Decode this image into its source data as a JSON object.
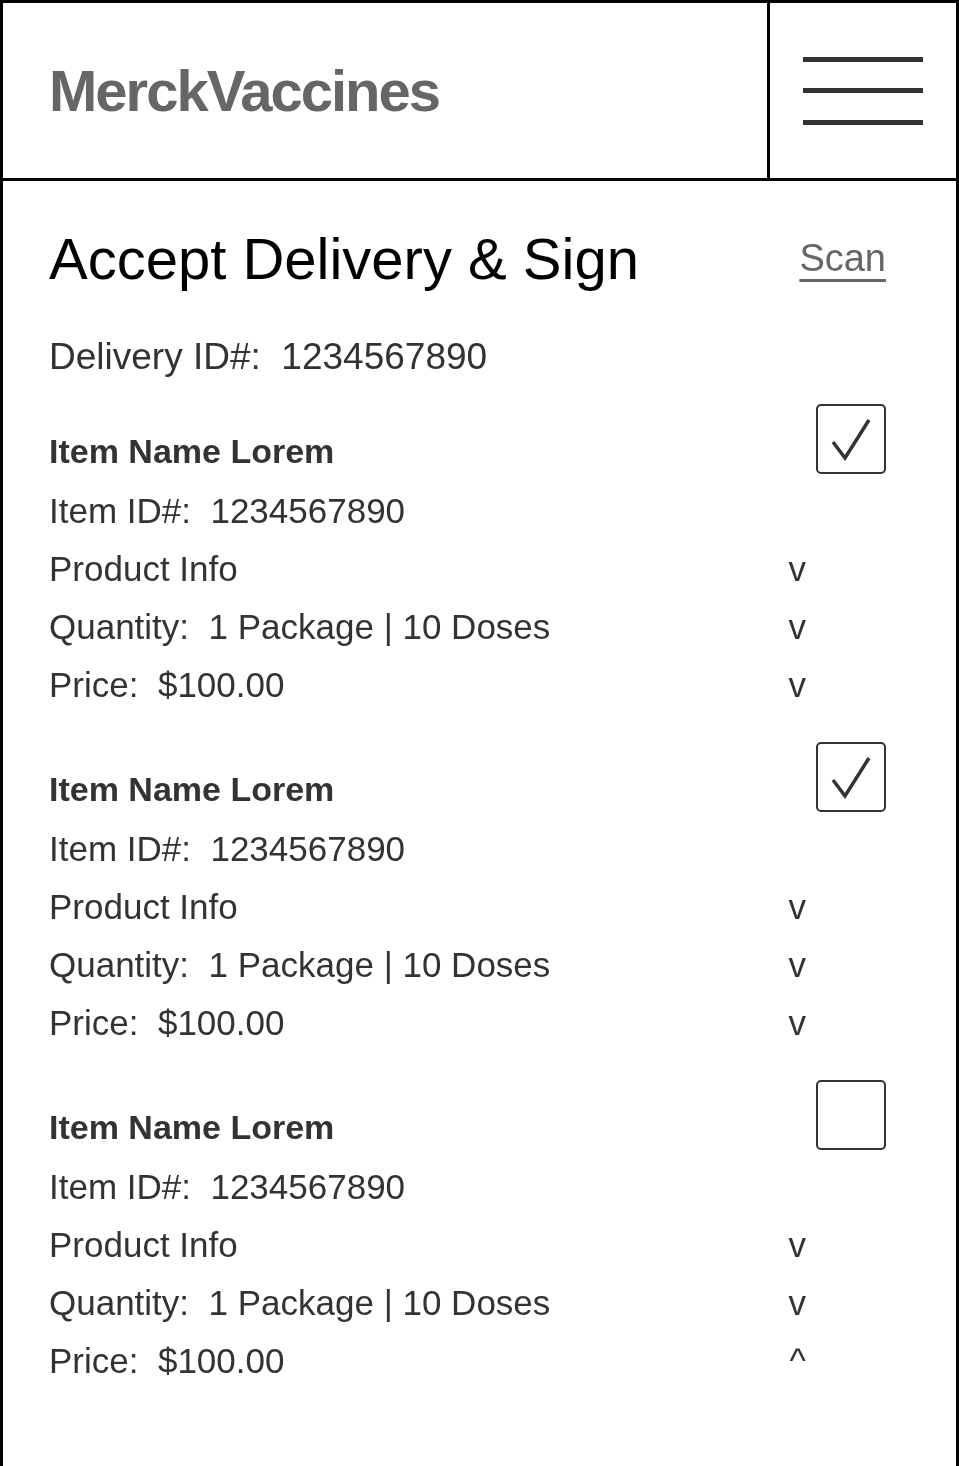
{
  "header": {
    "logo": "MerckVaccines"
  },
  "title": "Accept Delivery & Sign",
  "scan_link": "Scan",
  "delivery": {
    "label": "Delivery ID#:",
    "value": "1234567890"
  },
  "items": [
    {
      "name": "Item Name Lorem",
      "checked": true,
      "id_label": "Item ID#:",
      "id": "1234567890",
      "rows": [
        {
          "label": "Product Info",
          "toggle": "v"
        },
        {
          "label": "Quantity:",
          "value": "1 Package | 10 Doses",
          "toggle": "v"
        },
        {
          "label": "Price:",
          "value": "$100.00",
          "toggle": "v"
        }
      ]
    },
    {
      "name": "Item Name Lorem",
      "checked": true,
      "id_label": "Item ID#:",
      "id": "1234567890",
      "rows": [
        {
          "label": "Product Info",
          "toggle": "v"
        },
        {
          "label": "Quantity:",
          "value": "1 Package | 10 Doses",
          "toggle": "v"
        },
        {
          "label": "Price:",
          "value": "$100.00",
          "toggle": "v"
        }
      ]
    },
    {
      "name": "Item Name Lorem",
      "checked": false,
      "id_label": "Item ID#:",
      "id": "1234567890",
      "rows": [
        {
          "label": "Product Info",
          "toggle": "v"
        },
        {
          "label": "Quantity:",
          "value": "1 Package | 10 Doses",
          "toggle": "v"
        },
        {
          "label": "Price:",
          "value": "$100.00",
          "toggle": "^"
        }
      ]
    }
  ]
}
